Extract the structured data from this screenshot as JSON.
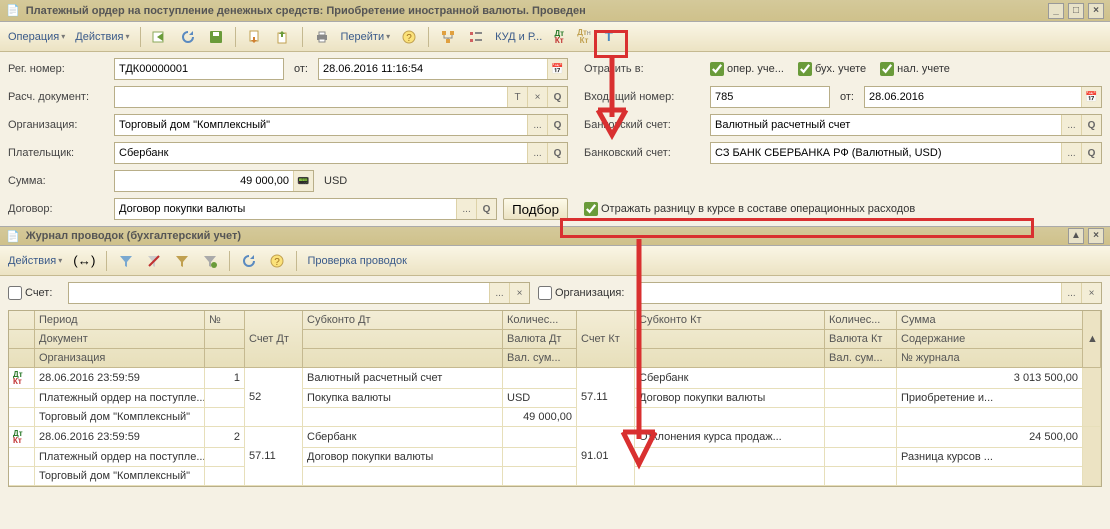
{
  "window": {
    "title": "Платежный ордер на поступление денежных средств: Приобретение иностранной валюты. Проведен"
  },
  "toolbar": {
    "operation": "Операция",
    "actions": "Действия",
    "goto": "Перейти",
    "kud": "КУД и Р..."
  },
  "form": {
    "reg_label": "Рег. номер:",
    "reg_value": "ТДК00000001",
    "from_label": "от:",
    "reg_date": "28.06.2016 11:16:54",
    "reflect_label": "Отразить в:",
    "chk_oper": "опер. уче...",
    "chk_buh": "бух. учете",
    "chk_nal": "нал. учете",
    "rasch_label": "Расч. документ:",
    "rasch_value": "",
    "incoming_label": "Входящий номер:",
    "incoming_value": "785",
    "incoming_date": "28.06.2016",
    "org_label": "Организация:",
    "org_value": "Торговый дом \"Комплексный\"",
    "bank_acc_label": "Банковский счет:",
    "bank_acc1": "Валютный расчетный счет",
    "payer_label": "Плательщик:",
    "payer_value": "Сбербанк",
    "bank_acc2": "СЗ БАНК СБЕРБАНКА РФ (Валютный, USD)",
    "sum_label": "Сумма:",
    "sum_value": "49 000,00",
    "currency": "USD",
    "contract_label": "Договор:",
    "contract_value": "Договор покупки валюты",
    "podbor": "Подбор",
    "reflect_diff": "Отражать разницу в курсе в составе операционных расходов"
  },
  "journal": {
    "title": "Журнал проводок (бухгалтерский учет)",
    "actions": "Действия",
    "check": "Проверка проводок",
    "filter_account": "Счет:",
    "filter_org": "Организация:"
  },
  "grid": {
    "h": {
      "period": "Период",
      "num": "№",
      "acc_dt": "Счет Дт",
      "sub_dt": "Субконто Дт",
      "qty_dt": "Количес...",
      "acc_kt": "Счет Кт",
      "sub_kt": "Субконто Кт",
      "qty_kt": "Количес...",
      "sum": "Сумма",
      "doc": "Документ",
      "cur_dt": "Валюта Дт",
      "cur_kt": "Валюта Кт",
      "content": "Содержание",
      "org": "Организация",
      "valsum_dt": "Вал. сум...",
      "valsum_kt": "Вал. сум...",
      "journal_no": "№ журнала"
    },
    "rows": [
      {
        "period": "28.06.2016 23:59:59",
        "n": "1",
        "acc_dt": "52",
        "sub_dt1": "Валютный расчетный счет",
        "qty_dt": "",
        "acc_kt": "57.11",
        "sub_kt1": "Сбербанк",
        "qty_kt": "",
        "sum": "3 013 500,00",
        "doc": "Платежный ордер на поступле...",
        "sub_dt2": "Покупка валюты",
        "cur_dt": "USD",
        "sub_kt2": "Договор покупки валюты",
        "content": "Приобретение и...",
        "org": "Торговый дом \"Комплексный\"",
        "valsum_dt": "49 000,00",
        "journal_no": ""
      },
      {
        "period": "28.06.2016 23:59:59",
        "n": "2",
        "acc_dt": "57.11",
        "sub_dt1": "Сбербанк",
        "qty_dt": "",
        "acc_kt": "91.01",
        "sub_kt1": "Отклонения курса продаж...",
        "qty_kt": "",
        "sum": "24 500,00",
        "doc": "Платежный ордер на поступле...",
        "sub_dt2": "Договор покупки валюты",
        "cur_dt": "",
        "sub_kt2": "",
        "content": "Разница курсов ...",
        "org": "Торговый дом \"Комплексный\"",
        "valsum_dt": "",
        "journal_no": ""
      }
    ]
  }
}
